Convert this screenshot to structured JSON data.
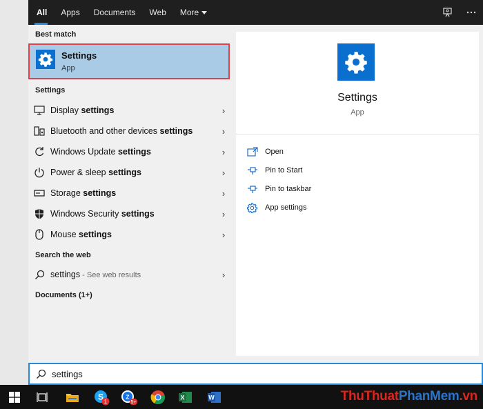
{
  "nav": {
    "tabs": [
      {
        "label": "All",
        "active": true
      },
      {
        "label": "Apps"
      },
      {
        "label": "Documents"
      },
      {
        "label": "Web"
      },
      {
        "label": "More"
      }
    ]
  },
  "left": {
    "best_match_heading": "Best match",
    "best_match": {
      "title": "Settings",
      "subtitle": "App",
      "icon": "gear-icon"
    },
    "settings_heading": "Settings",
    "settings_items": [
      {
        "pre": "Display ",
        "bold": "settings",
        "icon": "monitor-icon"
      },
      {
        "pre": "Bluetooth and other devices ",
        "bold": "settings",
        "icon": "devices-icon"
      },
      {
        "pre": "Windows Update ",
        "bold": "settings",
        "icon": "sync-icon"
      },
      {
        "pre": "Power & sleep ",
        "bold": "settings",
        "icon": "power-icon"
      },
      {
        "pre": "Storage ",
        "bold": "settings",
        "icon": "storage-icon"
      },
      {
        "pre": "Windows Security ",
        "bold": "settings",
        "icon": "shield-icon"
      },
      {
        "pre": "Mouse ",
        "bold": "settings",
        "icon": "mouse-icon"
      }
    ],
    "web_heading": "Search the web",
    "web_item": {
      "query": "settings",
      "hint": " - See web results"
    },
    "documents_heading": "Documents (1+)"
  },
  "preview": {
    "title": "Settings",
    "subtitle": "App",
    "actions": [
      {
        "label": "Open",
        "icon": "open-icon"
      },
      {
        "label": "Pin to Start",
        "icon": "pin-icon"
      },
      {
        "label": "Pin to taskbar",
        "icon": "pin-icon"
      },
      {
        "label": "App settings",
        "icon": "gear-icon"
      }
    ]
  },
  "search": {
    "value": "settings"
  },
  "taskbar": {
    "skype_badge": "1",
    "zalo_badge": "5+",
    "watermark_part1": "ThuThuat",
    "watermark_part2": "PhanMem",
    "watermark_part3": ".vn"
  },
  "colors": {
    "accent": "#2b87d8",
    "highlight": "#a9cbe6",
    "highlight_border": "#e0424b",
    "app_icon_bg": "#0a6fcf",
    "topbar": "#1f1f1f",
    "taskbar": "#111111"
  }
}
